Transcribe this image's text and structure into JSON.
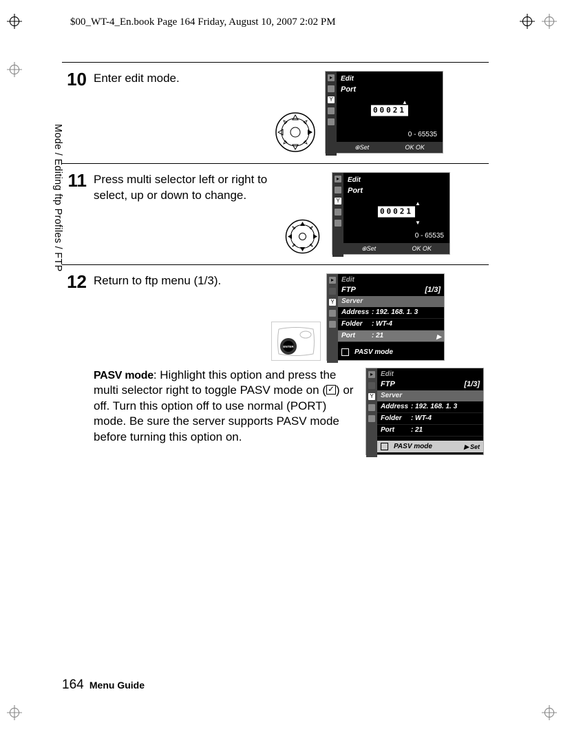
{
  "meta": {
    "header": "$00_WT-4_En.book  Page 164  Friday, August 10, 2007  2:02 PM"
  },
  "sidebar": "Mode / Editing ftp Profiles / FTP",
  "steps": {
    "s10": {
      "num": "10",
      "text": "Enter edit mode.",
      "lcd": {
        "title": "Edit",
        "sub": "Port",
        "value": "00021",
        "range": "0 - 65535",
        "footer_left": "⊕Set",
        "footer_right": "OK OK"
      }
    },
    "s11": {
      "num": "11",
      "text": "Press multi selector left or right to select, up or down to change.",
      "lcd": {
        "title": "Edit",
        "sub": "Port",
        "value": "00021",
        "range": "0 - 65535",
        "footer_left": "⊕Set",
        "footer_right": "OK OK"
      }
    },
    "s12": {
      "num": "12",
      "text": "Return to ftp menu (1/3).",
      "lcd": {
        "title": "Edit",
        "header_left": "FTP",
        "header_right": "[1/3]",
        "section": "Server",
        "rows": [
          {
            "k": "Address",
            "v": "192. 168. 1. 3"
          },
          {
            "k": "Folder",
            "v": "WT-4"
          },
          {
            "k": "Port",
            "v": "21",
            "hl": true
          }
        ],
        "pasv": "PASV mode"
      }
    }
  },
  "pasv_block": {
    "label": "PASV mode",
    "text1": ": Highlight this option and press the multi selector right to toggle PASV mode on (",
    "text2": ") or off.  Turn this option off to use normal (PORT) mode.  Be sure the server supports PASV mode before turning this option on.",
    "lcd": {
      "title": "Edit",
      "header_left": "FTP",
      "header_right": "[1/3]",
      "section": "Server",
      "rows": [
        {
          "k": "Address",
          "v": "192. 168. 1. 3"
        },
        {
          "k": "Folder",
          "v": "WT-4"
        },
        {
          "k": "Port",
          "v": "21"
        }
      ],
      "pasv": "PASV mode",
      "set": "Set"
    }
  },
  "footer": {
    "page_num": "164",
    "title": "Menu Guide"
  }
}
